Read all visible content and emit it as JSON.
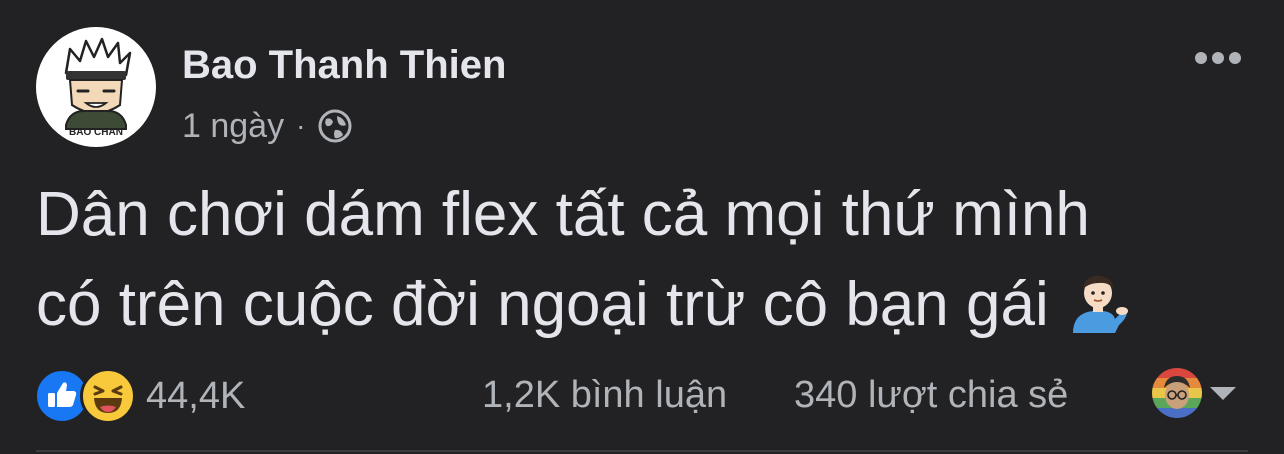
{
  "post": {
    "author": {
      "name": "Bao Thanh Thien",
      "avatar_caption": "BAO CHAN"
    },
    "timestamp": "1 ngày",
    "separator": "·",
    "audience_icon": "globe-icon",
    "text_lines": [
      "Dân chơi dám flex tất cả mọi thứ mình",
      "có trên cuộc đời ngoại trừ cô bạn gái"
    ],
    "text_emoji": "person-tipping-hand-emoji",
    "more_icon": "more-horizontal-icon"
  },
  "footer": {
    "reaction_icons": [
      "like-icon",
      "haha-icon"
    ],
    "reaction_count": "44,4K",
    "comments": "1,2K bình luận",
    "shares": "340 lượt chia sẻ",
    "viewer_menu_icon": "caret-down-icon"
  },
  "colors": {
    "background": "#222225",
    "primary_text": "#e4e6eb",
    "secondary_text": "#b0b3b8",
    "like_blue": "#1877f2",
    "haha_yellow": "#f7c93b"
  }
}
